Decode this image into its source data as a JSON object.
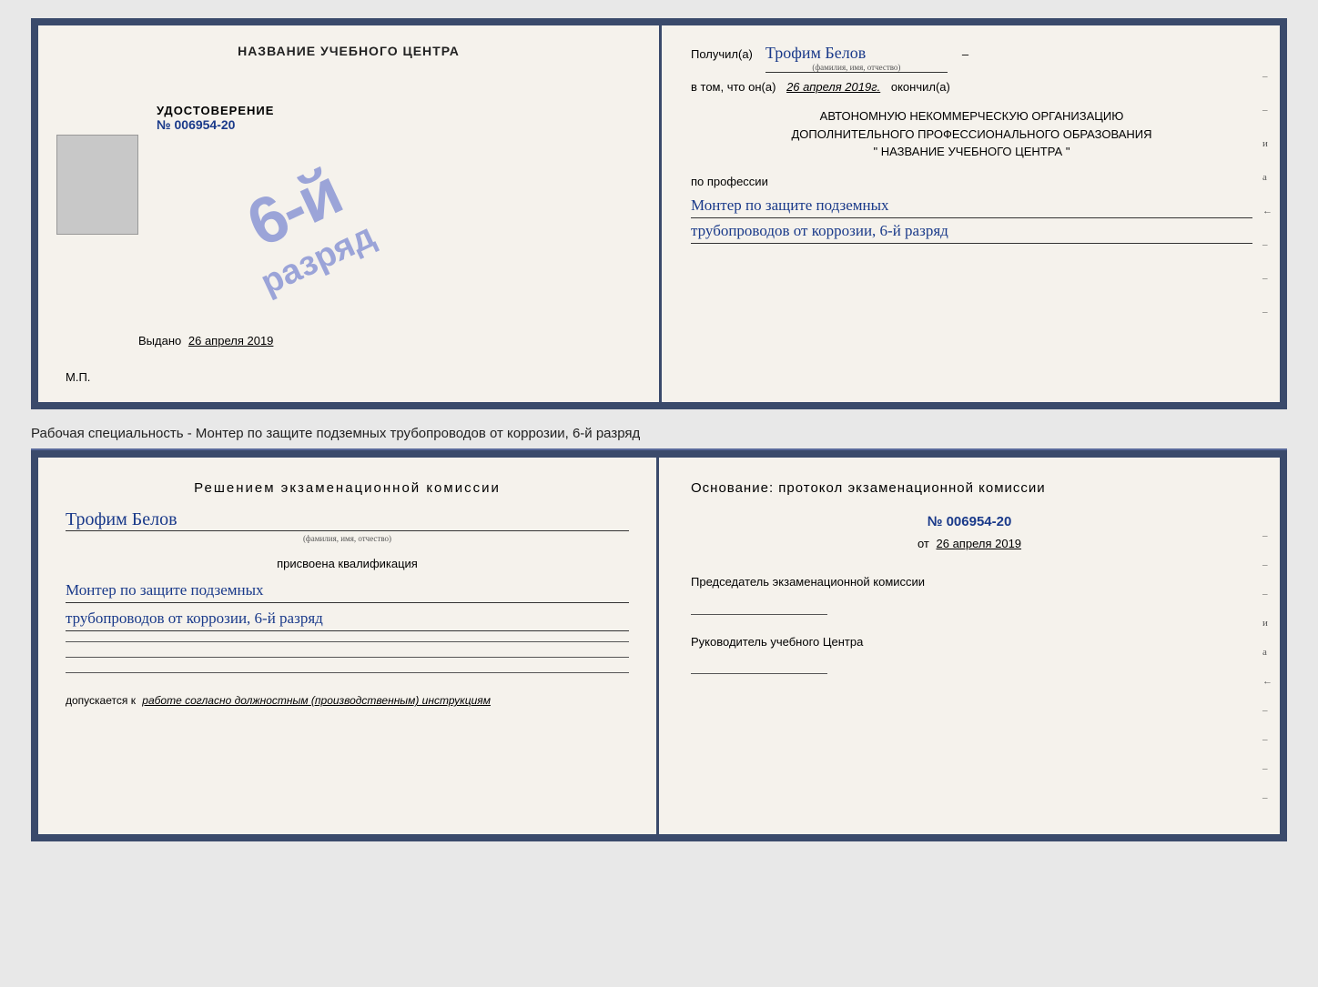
{
  "top_doc": {
    "left": {
      "header": "НАЗВАНИЕ УЧЕБНОГО ЦЕНТРА",
      "photo_alt": "photo",
      "cert_title": "УДОСТОВЕРЕНИЕ",
      "cert_number": "№ 006954-20",
      "stamp_line1": "6-й",
      "stamp_line2": "разряд",
      "issued_label": "Выдано",
      "issued_date": "26 апреля 2019",
      "mp_label": "М.П."
    },
    "right": {
      "received_label": "Получил(а)",
      "recipient_name": "Трофим Белов",
      "fio_label": "(фамилия, имя, отчество)",
      "dash": "–",
      "date_prefix": "в том, что он(а)",
      "date_value": "26 апреля 2019г.",
      "date_suffix": "окончил(а)",
      "org_line1": "АВТОНОМНУЮ НЕКОММЕРЧЕСКУЮ ОРГАНИЗАЦИЮ",
      "org_line2": "ДОПОЛНИТЕЛЬНОГО ПРОФЕССИОНАЛЬНОГО ОБРАЗОВАНИЯ",
      "org_line3": "\"  НАЗВАНИЕ УЧЕБНОГО ЦЕНТРА  \"",
      "profession_label": "по профессии",
      "profession_line1": "Монтер по защите подземных",
      "profession_line2": "трубопроводов от коррозии, 6-й разряд",
      "side_marks": [
        "–",
        "–",
        "и",
        "а",
        "←",
        "–",
        "–",
        "–"
      ]
    }
  },
  "specialty_text": "Рабочая специальность - Монтер по защите подземных трубопроводов от коррозии, 6-й разряд",
  "bottom_doc": {
    "left": {
      "commission_title": "Решением экзаменационной комиссии",
      "person_name": "Трофим Белов",
      "fio_label": "(фамилия, имя, отчество)",
      "qualification_label": "присвоена квалификация",
      "qualification_line1": "Монтер по защите подземных",
      "qualification_line2": "трубопроводов от коррозии, 6-й разряд",
      "admission_prefix": "допускается к",
      "admission_italic": "работе согласно должностным (производственным) инструкциям"
    },
    "right": {
      "basis_label": "Основание: протокол экзаменационной комиссии",
      "protocol_number": "№  006954-20",
      "protocol_date_prefix": "от",
      "protocol_date": "26 апреля 2019",
      "chairman_title": "Председатель экзаменационной комиссии",
      "head_title": "Руководитель учебного Центра",
      "side_marks": [
        "–",
        "–",
        "–",
        "и",
        "а",
        "←",
        "–",
        "–",
        "–",
        "–"
      ]
    }
  }
}
